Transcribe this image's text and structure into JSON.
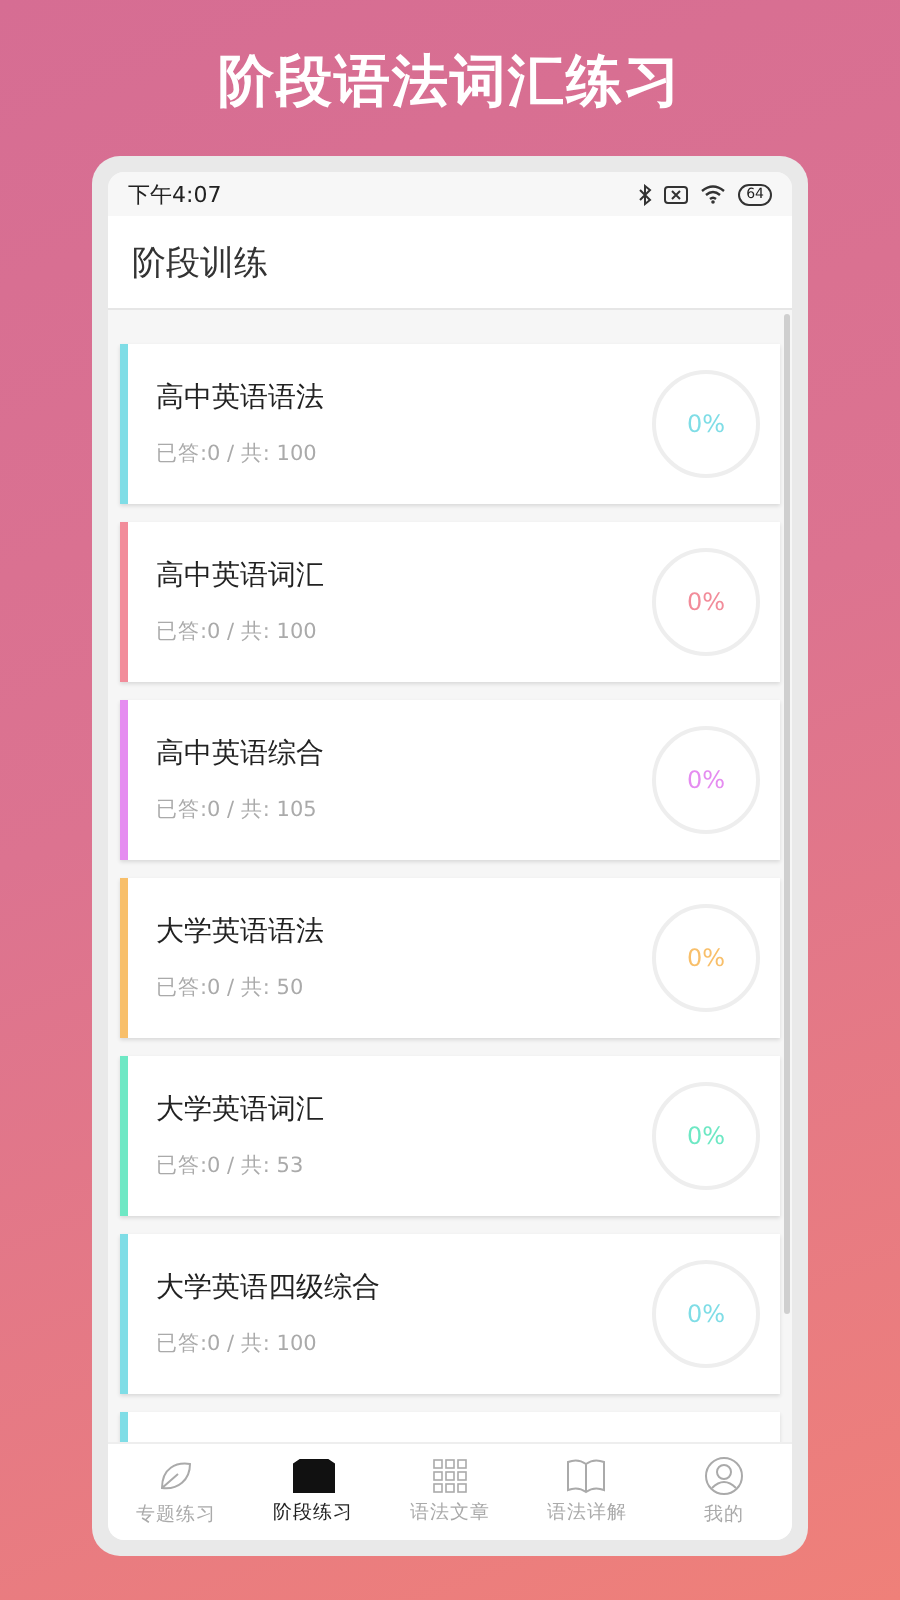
{
  "banner": {
    "title": "阶段语法词汇练习"
  },
  "status_bar": {
    "time": "下午4:07",
    "battery": "64"
  },
  "header": {
    "title": "阶段训练"
  },
  "cards": [
    {
      "title": "高中英语语法",
      "progress": "已答:0 / 共: 100",
      "percent": "0%",
      "color": "#7fdde6"
    },
    {
      "title": "高中英语词汇",
      "progress": "已答:0 / 共: 100",
      "percent": "0%",
      "color": "#f28c9a"
    },
    {
      "title": "高中英语综合",
      "progress": "已答:0 / 共: 105",
      "percent": "0%",
      "color": "#e58cf0"
    },
    {
      "title": "大学英语语法",
      "progress": "已答:0 / 共: 50",
      "percent": "0%",
      "color": "#f8bf6a"
    },
    {
      "title": "大学英语词汇",
      "progress": "已答:0 / 共: 53",
      "percent": "0%",
      "color": "#6ee8c4"
    },
    {
      "title": "大学英语四级综合",
      "progress": "已答:0 / 共: 100",
      "percent": "0%",
      "color": "#7fdde6"
    },
    {
      "color": "#7fdde6"
    }
  ],
  "nav": [
    {
      "label": "专题练习",
      "kind": "leaf",
      "selected": false
    },
    {
      "label": "阶段练习",
      "kind": "block",
      "selected": true
    },
    {
      "label": "语法文章",
      "kind": "grid",
      "selected": false
    },
    {
      "label": "语法详解",
      "kind": "book",
      "selected": false
    },
    {
      "label": "我的",
      "kind": "user",
      "selected": false
    }
  ]
}
